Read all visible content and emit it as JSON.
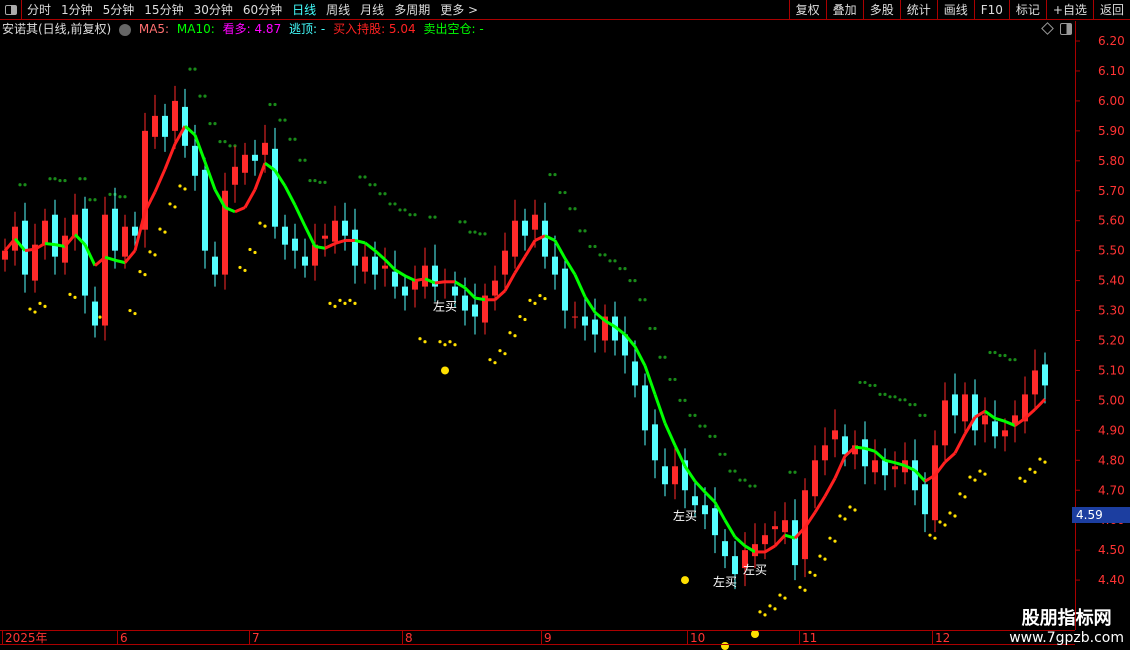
{
  "toolbar": {
    "tabs": [
      "分时",
      "1分钟",
      "5分钟",
      "15分钟",
      "30分钟",
      "60分钟",
      "日线",
      "周线",
      "月线",
      "多周期",
      "更多 >"
    ],
    "active": "日线",
    "right": [
      "复权",
      "叠加",
      "多股",
      "统计",
      "画线",
      "F10",
      "标记",
      "+自选",
      "返回"
    ]
  },
  "legend": {
    "title": "安诺其(日线,前复权)",
    "ma5": "MA5:",
    "ma10": "MA10:",
    "kanduo": "看多: 4.87",
    "taoding": "逃顶: -",
    "mairu": "买入持股: 5.04",
    "maichu": "卖出空仓: -"
  },
  "colors": {
    "up": "#ff2a2a",
    "down": "#54ffff",
    "ma_up": "#ff2020",
    "ma_down": "#00ff00",
    "dots_high": "#1a8a1a",
    "dots_low": "#ffe000"
  },
  "yaxis": {
    "labels": [
      "6.20",
      "6.10",
      "6.00",
      "5.90",
      "5.80",
      "5.70",
      "5.60",
      "5.50",
      "5.40",
      "5.30",
      "5.20",
      "5.10",
      "5.00",
      "4.90",
      "4.80",
      "4.70",
      "4.60",
      "4.50",
      "4.40"
    ]
  },
  "current_price": "4.59",
  "dateaxis": [
    "2025年",
    "6",
    "7",
    "8",
    "9",
    "10",
    "11",
    "12"
  ],
  "buy_label": "左买",
  "watermark": {
    "title": "股朋指标网",
    "url": "www.7gpzb.com"
  },
  "chart_data": {
    "type": "candlestick",
    "ylim": [
      4.35,
      6.22
    ],
    "closes": [
      5.5,
      5.58,
      5.42,
      5.52,
      5.6,
      5.48,
      5.55,
      5.62,
      5.35,
      5.25,
      5.62,
      5.5,
      5.58,
      5.55,
      5.9,
      5.95,
      5.88,
      6.0,
      5.85,
      5.75,
      5.5,
      5.42,
      5.7,
      5.78,
      5.82,
      5.8,
      5.86,
      5.58,
      5.52,
      5.5,
      5.45,
      5.52,
      5.55,
      5.6,
      5.55,
      5.45,
      5.48,
      5.42,
      5.45,
      5.38,
      5.35,
      5.4,
      5.45,
      5.38,
      5.4,
      5.35,
      5.3,
      5.28,
      5.35,
      5.4,
      5.5,
      5.6,
      5.55,
      5.62,
      5.48,
      5.42,
      5.3,
      5.28,
      5.25,
      5.22,
      5.28,
      5.2,
      5.15,
      5.05,
      4.9,
      4.8,
      4.72,
      4.78,
      4.7,
      4.65,
      4.62,
      4.55,
      4.48,
      4.42,
      4.5,
      4.52,
      4.55,
      4.58,
      4.6,
      4.45,
      4.7,
      4.8,
      4.85,
      4.9,
      4.82,
      4.85,
      4.78,
      4.8,
      4.75,
      4.78,
      4.8,
      4.7,
      4.62,
      4.85,
      5.0,
      4.95,
      5.02,
      4.9,
      4.95,
      4.88,
      4.9,
      4.95,
      5.02,
      5.1,
      5.05
    ],
    "buy_signals": [
      44,
      68,
      72,
      75
    ]
  }
}
